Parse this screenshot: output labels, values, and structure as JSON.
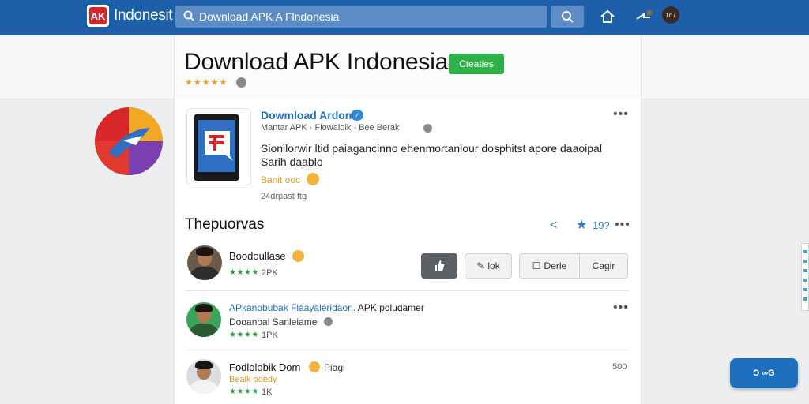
{
  "topbar": {
    "brand": "Indonesit",
    "search_value": "Download APK A Flndonesia",
    "user_avatar": "1n7"
  },
  "header": {
    "title": "Download APK Indonesia",
    "create_label": "Cteaties",
    "stars": "★★★★★"
  },
  "app": {
    "name": "Dowmload Ardons",
    "meta": "Mantar APK  ·  Flowaloik  ·  Bee Berak",
    "description": "Sionilorwir ltid paiagancinno ehenmortanlour dosphitst apore daaoipal Sarih daablo",
    "rank": "Banit ooc",
    "installs": "24drpast ftg"
  },
  "section": {
    "title": "Thepuorvas",
    "count": "19?"
  },
  "comments": [
    {
      "name": "Boodoullase",
      "stars": "★★★★",
      "sub": "2PK"
    },
    {
      "name_blue": "APkanobubak",
      "name_rest": " Flaayaléridaon.",
      "extra": " APK poludamer",
      "sub": "Dooanoai Sanleiame",
      "stars": "★★★★",
      "count": "1PK"
    },
    {
      "name": "Fodlolobik  Dom",
      "extra": "Piagi",
      "sub": "Bealk ooedy",
      "stars": "★★★★",
      "count": "1K",
      "time": "500"
    }
  ],
  "actions": {
    "link": "lok",
    "reply": "Derle",
    "copy": "Cagir"
  },
  "fab": {
    "label": "Ɔ ∞G"
  },
  "colors": {
    "topbar": "#1d5fa8",
    "accent_green": "#2fb14a",
    "link_blue": "#1f6fbf",
    "star_green": "#2a9d3a"
  }
}
